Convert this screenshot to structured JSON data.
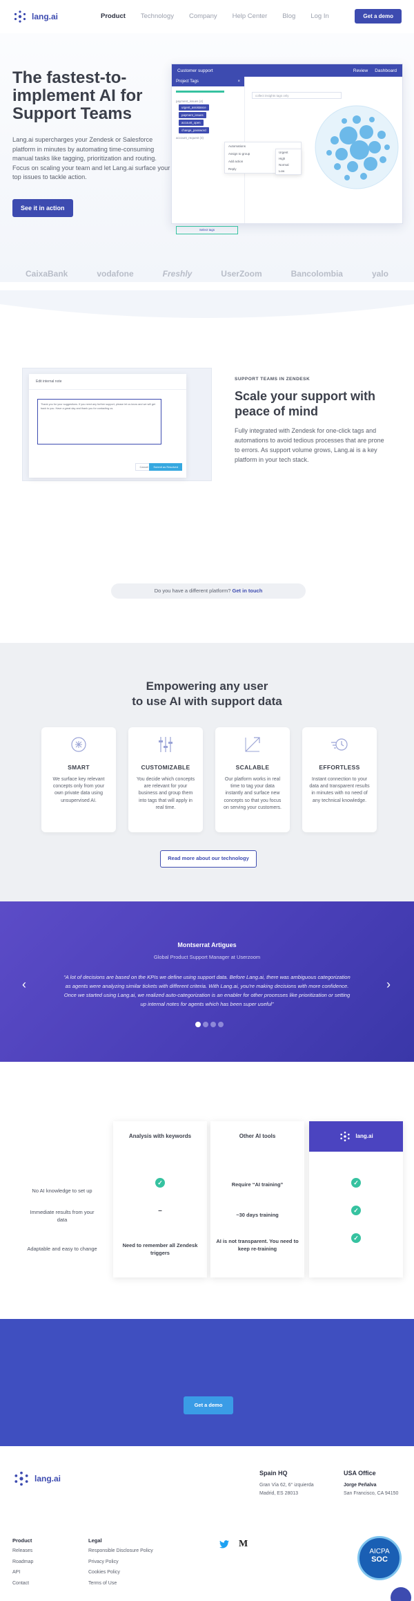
{
  "nav": {
    "brand": "lang.ai",
    "links": [
      "Product",
      "Technology",
      "Company",
      "Help Center",
      "Blog",
      "Log In"
    ],
    "cta": "Get a demo"
  },
  "hero": {
    "title": "The fastest-to-implement AI for Support Teams",
    "description": "Lang.ai supercharges your Zendesk or Salesforce platform in minutes by automating time-consuming manual tasks like tagging, prioritization and routing. Focus on scaling your team and let Lang.ai surface your top issues to tackle action.",
    "button": "See it in action"
  },
  "app": {
    "bar_title": "Customer support",
    "bar_right": [
      "Review",
      "Dashboard"
    ],
    "panel_title": "Project Tags",
    "select_label": "Select tags",
    "search_placeholder": "collect insights tags only",
    "tags": [
      "urgent_assistance",
      "payment_issues",
      "account_open",
      "change_password"
    ],
    "tag_group_1": "payment_issues (4)",
    "tag_group_2": "account_request (3)",
    "menu_items": [
      "Automations",
      "Assign to group",
      "Add action",
      "Reply"
    ],
    "submenu_items": [
      "Urgent",
      "High",
      "Normal",
      "Low"
    ],
    "accent": "#3d4bb0"
  },
  "logos": [
    "CaixaBank",
    "vodafone",
    "Freshly",
    "UserZoom",
    "Bancolombia",
    "yalo"
  ],
  "scale": {
    "kicker": "SUPPORT TEAMS IN ZENDESK",
    "title": "Scale your support with peace of mind",
    "description": "Fully integrated with Zendesk for one-click tags and automations to avoid tedious processes that are prone to errors. As support volume grows, Lang.ai is a key platform in your tech stack.",
    "card_title": "Edit internal note",
    "note_text": "Thank you for your suggestions. If you need any further support, please let us know and we will get back to you. Have a great day and thank you for contacting us.",
    "cancel": "Cancel",
    "save": "Submit as Resolved"
  },
  "platform": {
    "text": "Do you have a different platform?",
    "link": "Get in touch"
  },
  "empower": {
    "title_line1": "Empowering any user",
    "title_line2": "to use AI with support data",
    "features": [
      {
        "name": "SMART",
        "text": "We surface key relevant concepts only from your own private data using unsupervised AI."
      },
      {
        "name": "CUSTOMIZABLE",
        "text": "You decide which concepts are relevant for your business and group them into tags that will apply in real time."
      },
      {
        "name": "SCALABLE",
        "text": "Our platform works in real time to tag your data instantly and surface new concepts so that you focus on serving your customers."
      },
      {
        "name": "EFFORTLESS",
        "text": "Instant connection to your data and transparent results in minutes with no need of any technical knowledge."
      }
    ],
    "button": "Read more about our technology"
  },
  "testimonial": {
    "name": "Montserrat Artigues",
    "role": "Global Product Support Manager at Userzoom",
    "quote": "“A lot of decisions are based on the KPIs we define using support data. Before Lang.ai, there was ambiguous categorization as agents were analyzing similar tickets with different criteria. With Lang.ai, you're making decisions with more confidence. Once we started using Lang.ai, we realized auto-categorization is an enabler for other processes like prioritization or setting up internal notes for agents which has been super useful”",
    "prev": "‹",
    "next": "›"
  },
  "comparison": {
    "rows": [
      "No AI knowledge to set up",
      "Immediate results from your data",
      "Adaptable and easy to change"
    ],
    "col_keywords": {
      "title": "Analysis with keywords",
      "cells": [
        "✓",
        "–",
        "Need to remember all Zendesk triggers"
      ]
    },
    "col_other": {
      "title": "Other AI tools",
      "cells": [
        "Require “AI training”",
        "~30 days training",
        "AI is not transparent. You need to keep re-training"
      ]
    },
    "col_lang": {
      "title": "lang.ai",
      "cells": [
        "✓",
        "✓",
        "✓"
      ]
    }
  },
  "cta": {
    "button": "Get a demo"
  },
  "footer": {
    "brand": "lang.ai",
    "spain_title": "Spain HQ",
    "spain_addr1": "Gran Vía 62, 6° izquierda",
    "spain_addr2": "Madrid, ES 28013",
    "usa_title": "USA Office",
    "usa_person": "Jorge Peñalva",
    "usa_addr": "San Francisco, CA 94150",
    "product_title": "Product",
    "product_links": [
      "Releases",
      "Roadmap",
      "API",
      "Contact"
    ],
    "legal_title": "Legal",
    "legal_links": [
      "Responsible Disclosure Policy",
      "Privacy Policy",
      "Cookies Policy",
      "Terms of Use"
    ],
    "social": [
      "twitter-icon",
      "medium-icon"
    ],
    "medium_letter": "M",
    "badge_top": "AICPA",
    "badge_bottom": "SOC"
  }
}
